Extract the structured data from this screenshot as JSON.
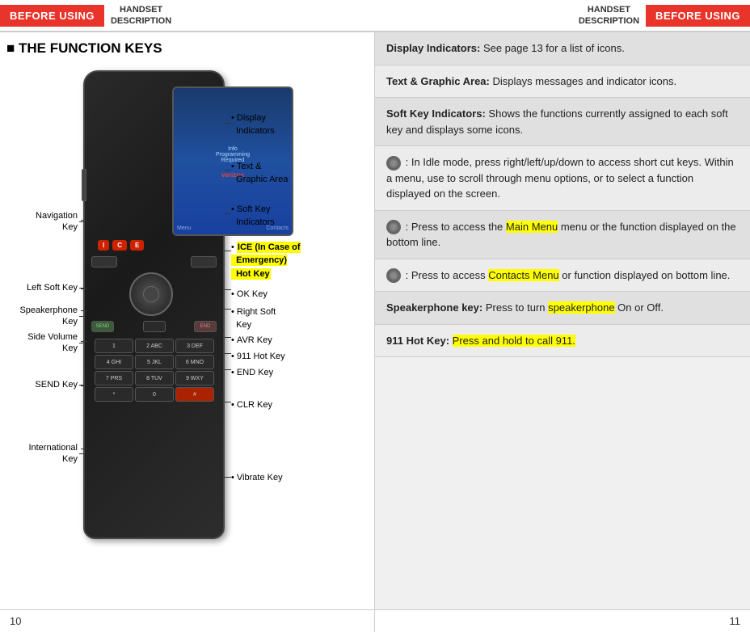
{
  "header": {
    "left": {
      "before_using": "BEFORE USING",
      "handset_line1": "HANDSET",
      "handset_line2": "DESCRIPTION"
    },
    "right": {
      "handset_line1": "HANDSET",
      "handset_line2": "DESCRIPTION",
      "before_using": "BEFORE USING"
    }
  },
  "left_panel": {
    "section_title": "■ THE FUNCTION KEYS",
    "labels_right": [
      {
        "id": "navigation-key",
        "text": "Navigation\nKey"
      },
      {
        "id": "left-soft-key",
        "text": "Left Soft Key"
      },
      {
        "id": "speakerphone-key",
        "text": "Speakerphone\nKey"
      },
      {
        "id": "side-volume-key",
        "text": "Side Volume\nKey"
      },
      {
        "id": "send-key",
        "text": "SEND Key"
      },
      {
        "id": "international-key",
        "text": "International\nKey"
      }
    ],
    "labels_right_dot": [
      {
        "id": "display-indicators",
        "text": "Display\nIndicators"
      },
      {
        "id": "text-graphic-area",
        "text": "Text &\nGraphic Area"
      },
      {
        "id": "soft-key-indicators",
        "text": "Soft Key\nIndicators"
      },
      {
        "id": "ice-key",
        "text": "ICE (In Case of\nEmergency)\nHot Key",
        "highlight": true
      },
      {
        "id": "ok-key",
        "text": "OK Key"
      },
      {
        "id": "right-soft-key",
        "text": "Right Soft\nKey"
      },
      {
        "id": "avr-key",
        "text": "AVR Key"
      },
      {
        "id": "911-hot-key",
        "text": "911 Hot Key"
      },
      {
        "id": "end-key",
        "text": "END Key"
      },
      {
        "id": "clr-key",
        "text": "CLR Key"
      },
      {
        "id": "vibrate-key",
        "text": "Vibrate Key"
      }
    ]
  },
  "right_panel": {
    "blocks": [
      {
        "id": "display-indicators-desc",
        "bold": "Display Indicators:",
        "text": " See page 13 for a list of icons."
      },
      {
        "id": "text-graphic-area-desc",
        "bold": "Text & Graphic Area:",
        "text": " Displays messages and indicator icons."
      },
      {
        "id": "soft-key-indicators-desc",
        "bold": "Soft Key Indicators:",
        "text": " Shows the functions currently assigned to each soft key and displays some icons."
      },
      {
        "id": "nav-key-desc",
        "bold": "",
        "text": " : In Idle mode, press right/left/up/down to access short cut keys. Within a menu, use to scroll through menu options, or to select a function displayed on the screen.",
        "has_nav_icon": true
      },
      {
        "id": "main-menu-desc",
        "bold": "",
        "text": " : Press to access the ",
        "highlight_text": "Main Menu",
        "text2": " menu or the function displayed on the bottom line.",
        "has_ok_icon": true
      },
      {
        "id": "contacts-menu-desc",
        "bold": "",
        "text": " : Press to access ",
        "highlight_text": "Contacts Menu",
        "text2": " or function displayed on bottom line.",
        "has_contacts_icon": true
      },
      {
        "id": "speakerphone-desc",
        "bold": "Speakerphone key:",
        "text": " Press to turn ",
        "highlight_text": "speakerphone",
        "text2": " On or Off."
      },
      {
        "id": "911-hot-key-desc",
        "bold": "911 Hot Key:",
        "text": " ",
        "highlight_text": "Press and hold to call 911.",
        "text2": ""
      }
    ]
  },
  "footer": {
    "left_page": "10",
    "right_page": "11"
  }
}
